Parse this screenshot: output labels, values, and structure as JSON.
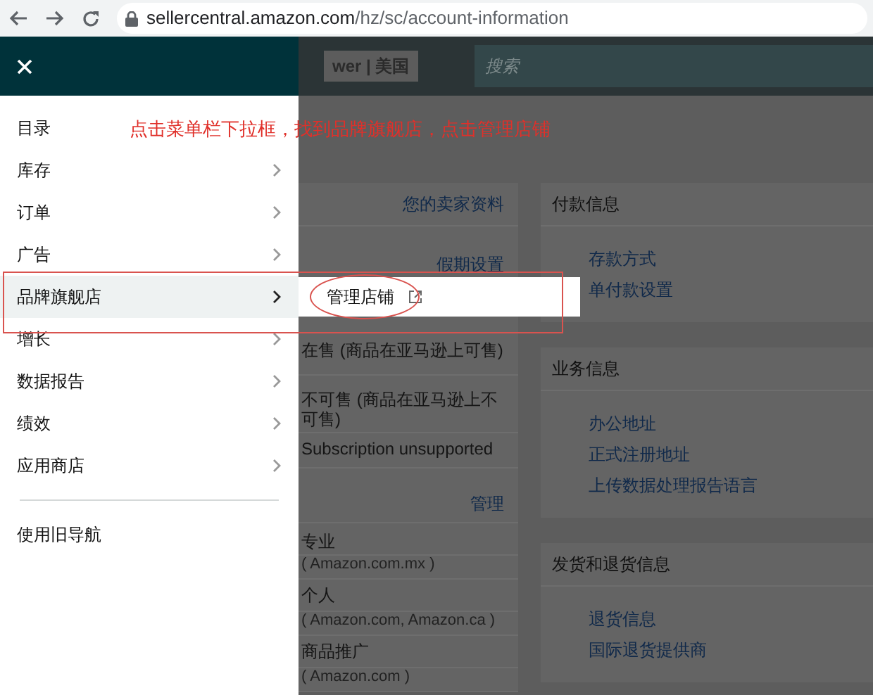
{
  "browser": {
    "url_host": "sellercentral.amazon.com",
    "url_path": "/hz/sc/account-information"
  },
  "header": {
    "store": "wer | 美国",
    "search_placeholder": "搜索"
  },
  "menu": {
    "items": [
      {
        "label": "目录",
        "has_submenu": false,
        "selected": false
      },
      {
        "label": "库存",
        "has_submenu": true,
        "selected": false
      },
      {
        "label": "订单",
        "has_submenu": true,
        "selected": false
      },
      {
        "label": "广告",
        "has_submenu": true,
        "selected": false
      },
      {
        "label": "品牌旗舰店",
        "has_submenu": true,
        "selected": true
      },
      {
        "label": "增长",
        "has_submenu": true,
        "selected": false
      },
      {
        "label": "数据报告",
        "has_submenu": true,
        "selected": false
      },
      {
        "label": "绩效",
        "has_submenu": true,
        "selected": false
      },
      {
        "label": "应用商店",
        "has_submenu": true,
        "selected": false
      }
    ],
    "footer_item": "使用旧导航"
  },
  "flyout": {
    "items": [
      {
        "label": "管理店铺",
        "external": true
      }
    ]
  },
  "annotation": "点击菜单栏下拉框，找到品牌旗舰店，点击管理店铺",
  "left_column": [
    {
      "kind": "link",
      "text": "您的卖家资料"
    },
    {
      "kind": "link",
      "text": "假期设置"
    },
    {
      "kind": "text",
      "text": "在售 (商品在亚马逊上可售)"
    },
    {
      "kind": "text",
      "text": "不可售 (商品在亚马逊上不可售)"
    },
    {
      "kind": "subtext",
      "text": "Subscription unsupported"
    },
    {
      "kind": "link",
      "text": "管理"
    },
    {
      "kind": "text",
      "text": "专业"
    },
    {
      "kind": "note",
      "text": "( Amazon.com.mx )"
    },
    {
      "kind": "text",
      "text": "个人"
    },
    {
      "kind": "note",
      "text": "( Amazon.com, Amazon.ca )"
    },
    {
      "kind": "text",
      "text": "商品推广"
    },
    {
      "kind": "note",
      "text": "( Amazon.com )"
    }
  ],
  "right_column": [
    {
      "title": "付款信息",
      "links": [
        "存款方式",
        "单付款设置"
      ]
    },
    {
      "title": "业务信息",
      "links": [
        "办公地址",
        "正式注册地址",
        "上传数据处理报告语言"
      ]
    },
    {
      "title": "发货和退货信息",
      "links": [
        "退货信息",
        "国际退货提供商"
      ]
    }
  ]
}
